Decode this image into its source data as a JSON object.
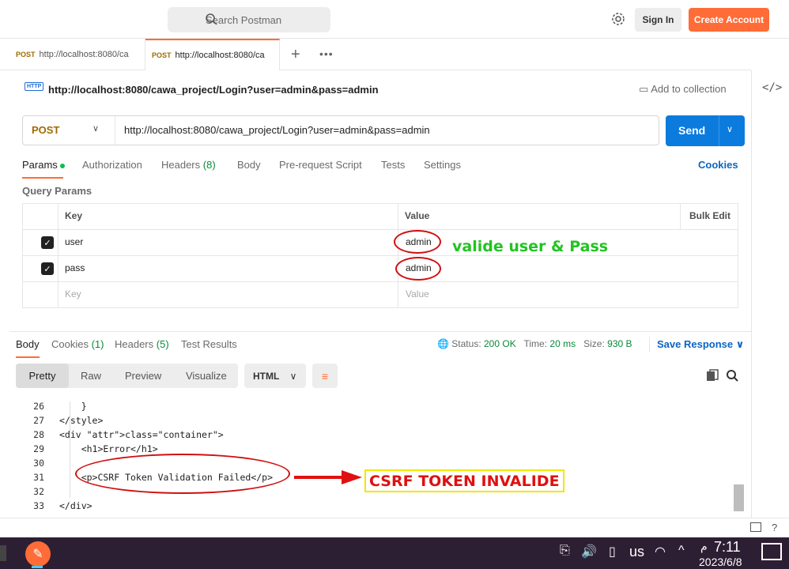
{
  "topbar": {
    "search_placeholder": "Search Postman",
    "signin_label": "Sign In",
    "create_label": "Create Account"
  },
  "tabs": [
    {
      "method": "POST",
      "title": "http://localhost:8080/ca"
    },
    {
      "method": "POST",
      "title": "http://localhost:8080/ca"
    }
  ],
  "request": {
    "title": "http://localhost:8080/cawa_project/Login?user=admin&pass=admin",
    "add_collection": "Add to collection",
    "method": "POST",
    "url": "http://localhost:8080/cawa_project/Login?user=admin&pass=admin",
    "send_label": "Send"
  },
  "req_tabs": {
    "params": "Params",
    "authorization": "Authorization",
    "headers": "Headers",
    "headers_count": "(8)",
    "body": "Body",
    "prerequest": "Pre-request Script",
    "tests": "Tests",
    "settings": "Settings",
    "cookies": "Cookies"
  },
  "query_params": {
    "heading": "Query Params",
    "col_key": "Key",
    "col_value": "Value",
    "bulk_edit": "Bulk Edit",
    "rows": [
      {
        "key": "user",
        "value": "admin",
        "checked": true
      },
      {
        "key": "pass",
        "value": "admin",
        "checked": true
      }
    ],
    "placeholder_key": "Key",
    "placeholder_value": "Value"
  },
  "annotation_green": "valide user & Pass",
  "response": {
    "tabs": {
      "body": "Body",
      "cookies": "Cookies",
      "cookies_count": "(1)",
      "headers": "Headers",
      "headers_count": "(5)",
      "test_results": "Test Results"
    },
    "status_label": "Status:",
    "status_value": "200 OK",
    "time_label": "Time:",
    "time_value": "20 ms",
    "size_label": "Size:",
    "size_value": "930 B",
    "save_label": "Save Response",
    "views": [
      "Pretty",
      "Raw",
      "Preview",
      "Visualize"
    ],
    "format": "HTML"
  },
  "code_lines": [
    {
      "n": "26",
      "text": "    }"
    },
    {
      "n": "27",
      "text": "</style>"
    },
    {
      "n": "28",
      "text": "<div class=\"container\">"
    },
    {
      "n": "29",
      "text": "    <h1>Error</h1>"
    },
    {
      "n": "30",
      "text": ""
    },
    {
      "n": "31",
      "text": "    <p>CSRF Token Validation Failed</p>"
    },
    {
      "n": "32",
      "text": ""
    },
    {
      "n": "33",
      "text": "</div>"
    }
  ],
  "annotation_red": "CSRF TOKEN INVALIDE",
  "taskbar": {
    "lang": "us",
    "time": "7:11",
    "ampm": "م",
    "date": "2023/6/8"
  }
}
